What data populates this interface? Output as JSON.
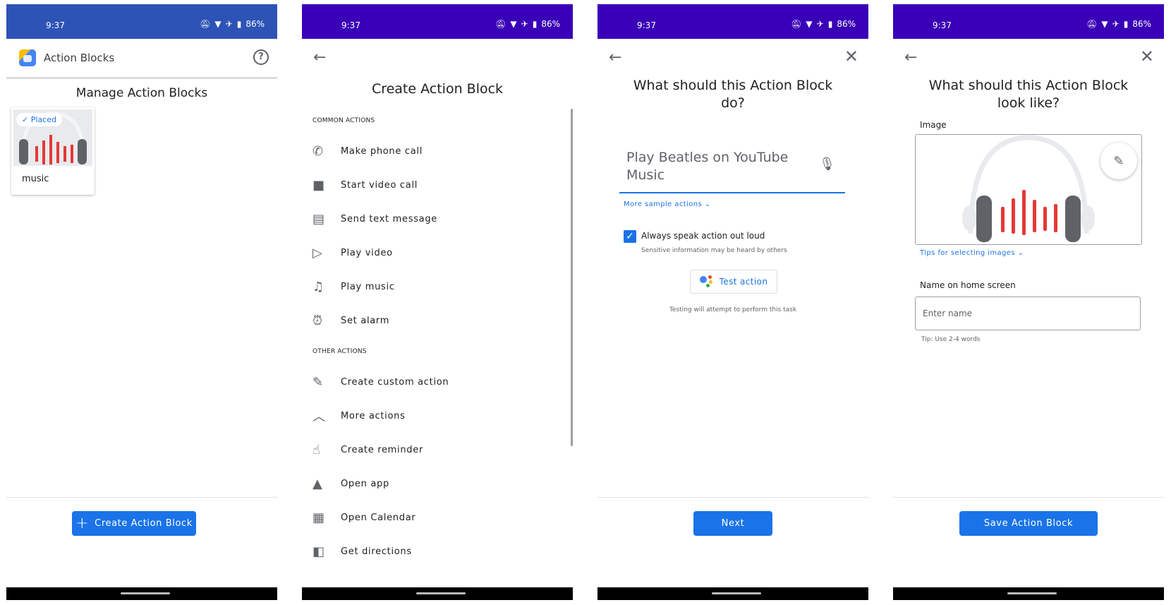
{
  "status": {
    "time": "9:37",
    "battery": "86%"
  },
  "screen1": {
    "app_title": "Action Blocks",
    "section_title": "Manage Action Blocks",
    "block": {
      "chip": "✓ Placed",
      "label": "music"
    },
    "create_button": "Create Action Block"
  },
  "screen2": {
    "title": "Create Action Block",
    "common_header": "COMMON ACTIONS",
    "common_actions": [
      {
        "icon": "phone-icon",
        "label": "Make phone call"
      },
      {
        "icon": "video-camera-icon",
        "label": "Start video call"
      },
      {
        "icon": "message-icon",
        "label": "Send text message"
      },
      {
        "icon": "play-circle-icon",
        "label": "Play video"
      },
      {
        "icon": "music-library-icon",
        "label": "Play music"
      },
      {
        "icon": "alarm-icon",
        "label": "Set alarm"
      }
    ],
    "other_header": "OTHER ACTIONS",
    "other_actions": [
      {
        "icon": "pencil-icon",
        "label": "Create custom action"
      },
      {
        "icon": "chevron-up-icon",
        "label": "More actions"
      },
      {
        "icon": "reminder-icon",
        "label": "Create reminder"
      },
      {
        "icon": "android-icon",
        "label": "Open app"
      },
      {
        "icon": "calendar-icon",
        "label": "Open Calendar"
      },
      {
        "icon": "map-icon",
        "label": "Get directions"
      }
    ]
  },
  "screen3": {
    "title": "What should this Action Block do?",
    "input_value": "Play Beatles on YouTube Music",
    "more_samples": "More sample actions",
    "speak_label": "Always speak action out loud",
    "speak_checked": true,
    "speak_sub": "Sensitive information may be heard by others",
    "test_button": "Test action",
    "test_note": "Testing will attempt to perform this task",
    "next_button": "Next"
  },
  "screen4": {
    "title": "What should this Action Block look like?",
    "image_label": "Image",
    "tips_link": "Tips for selecting images",
    "name_label": "Name on home screen",
    "name_placeholder": "Enter name",
    "name_tip": "Tip: Use 2-4 words",
    "save_button": "Save Action Block"
  },
  "colors": {
    "accent": "#1a73e8",
    "statusbar": "#3a00b8",
    "statusbar_first": "#2d53b6",
    "music_red": "#e53935"
  }
}
